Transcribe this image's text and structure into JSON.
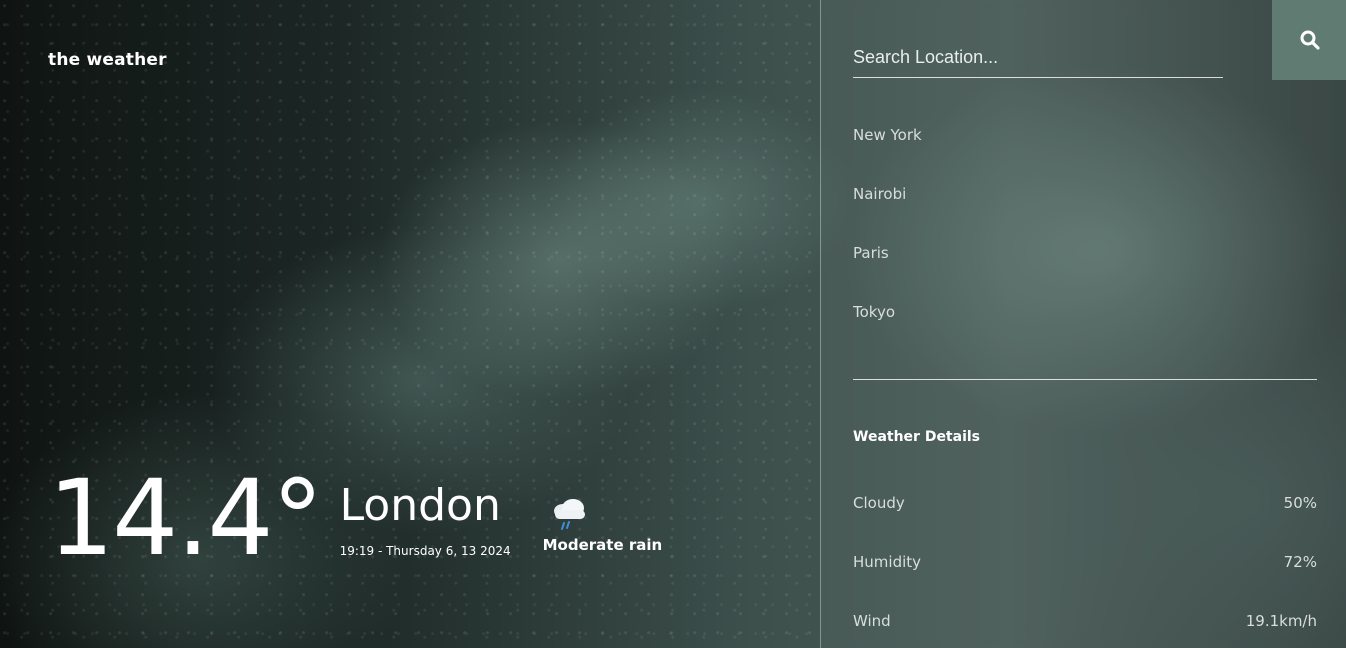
{
  "brand": {
    "title": "the weather"
  },
  "current": {
    "temperature": "14.4°",
    "city": "London",
    "datetime": "19:19 - Thursday 6, 13 2024",
    "condition": "Moderate rain",
    "condition_icon": "rain-cloud-icon"
  },
  "search": {
    "placeholder": "Search Location...",
    "value": "",
    "button_icon": "search-icon",
    "button_color": "#5f7b72"
  },
  "locations": [
    {
      "label": "New York"
    },
    {
      "label": "Nairobi"
    },
    {
      "label": "Paris"
    },
    {
      "label": "Tokyo"
    }
  ],
  "details": {
    "title": "Weather Details",
    "rows": [
      {
        "label": "Cloudy",
        "value": "50%"
      },
      {
        "label": "Humidity",
        "value": "72%"
      },
      {
        "label": "Wind",
        "value": "19.1km/h"
      }
    ]
  }
}
